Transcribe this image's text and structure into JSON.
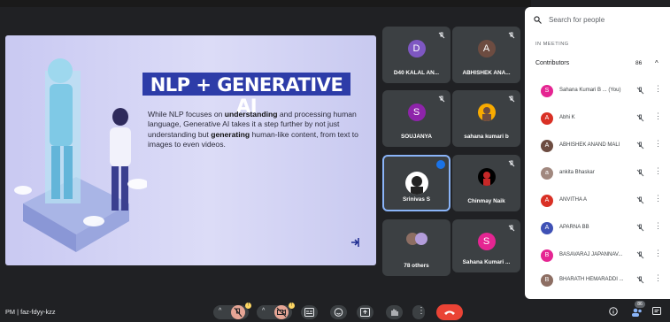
{
  "slide": {
    "title": "NLP + GENERATIVE AI",
    "body_1": "While NLP focuses on ",
    "body_bold_1": "understanding",
    "body_2": " and processing human language, Generative AI takes it a step further by not just understanding but ",
    "body_bold_2": "generating",
    "body_3": " human-like content, from text to images to even videos."
  },
  "tiles": [
    {
      "name": "D40 KALAL AN...",
      "initial": "D",
      "color": "#7e57c2"
    },
    {
      "name": "ABHISHEK ANA...",
      "initial": "A",
      "color": "#6d4c41"
    },
    {
      "name": "SOUJANYA",
      "initial": "S",
      "color": "#8e24aa"
    },
    {
      "name": "sahana kumari b",
      "initial": "",
      "color": "#f9ab00"
    },
    {
      "name": "Srinivas S",
      "initial": "",
      "color": "#ffffff"
    },
    {
      "name": "Chinmay Naik",
      "initial": "",
      "color": "#000000"
    },
    {
      "name": "78 others",
      "initial": "",
      "color": "#8d6e63"
    },
    {
      "name": "Sahana Kumari ...",
      "initial": "S",
      "color": "#e52592"
    }
  ],
  "panel": {
    "search_placeholder": "Search for people",
    "section_label": "IN MEETING",
    "contributors_label": "Contributors",
    "contributors_count": "86",
    "people": [
      {
        "name": "Sahana Kumari B ...  (You)",
        "initial": "S",
        "color": "#e52592"
      },
      {
        "name": "Abhi K",
        "initial": "A",
        "color": "#d93025"
      },
      {
        "name": "ABHISHEK ANAND MALI",
        "initial": "A",
        "color": "#6d4c41"
      },
      {
        "name": "ankita Bhaskar",
        "initial": "a",
        "color": "#a1887f"
      },
      {
        "name": "ANVITHA A",
        "initial": "A",
        "color": "#d93025"
      },
      {
        "name": "APARNA BB",
        "initial": "A",
        "color": "#3f51b5"
      },
      {
        "name": "BASAVARAJ JAPANNAV...",
        "initial": "B",
        "color": "#e52592"
      },
      {
        "name": "BHARATH HEMARADDI ...",
        "initial": "B",
        "color": "#8d6e63"
      }
    ]
  },
  "bottom": {
    "meeting_info": "PM  |  faz-fdyy-kzz",
    "participant_count": "86",
    "mic_badge": "!",
    "cam_badge": "!"
  }
}
